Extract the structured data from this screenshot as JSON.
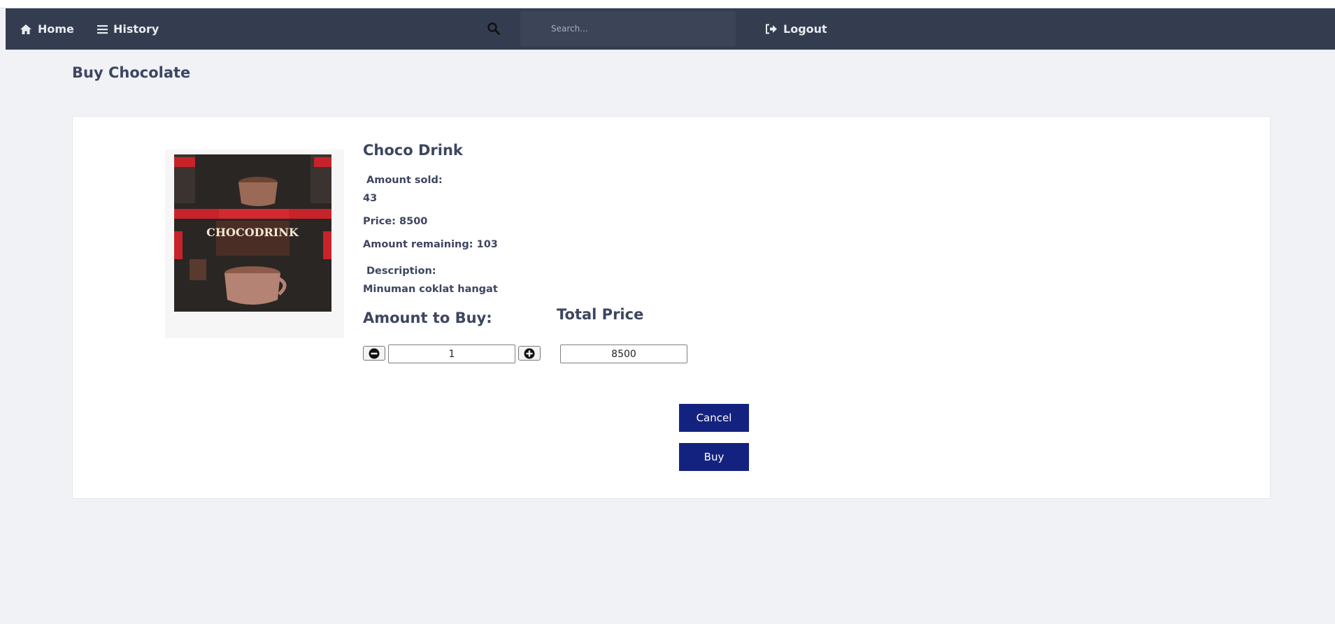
{
  "nav": {
    "home_label": "Home",
    "history_label": "History",
    "search_placeholder": "Search...",
    "logout_label": "Logout"
  },
  "page": {
    "title": "Buy Chocolate"
  },
  "product": {
    "name": "Choco Drink",
    "image_alt": "CHOCODRINK",
    "amount_sold_label": "Amount sold:",
    "amount_sold_value": "43",
    "price_text": "Price: 8500",
    "remaining_text": "Amount remaining: 103",
    "description_label": "Description:",
    "description_value": "Minuman coklat hangat"
  },
  "purchase": {
    "amount_heading": "Amount to Buy:",
    "total_heading": "Total Price",
    "quantity": "1",
    "total_price": "8500",
    "cancel_label": "Cancel",
    "buy_label": "Buy"
  },
  "colors": {
    "navbar": "#333d4f",
    "background": "#f1f2f6",
    "text": "#3d4660",
    "button": "#14227f"
  },
  "icons": {
    "home": "home-icon",
    "history": "list-icon",
    "search": "search-icon",
    "logout": "logout-icon",
    "minus": "minus-circle-icon",
    "plus": "plus-circle-icon"
  }
}
